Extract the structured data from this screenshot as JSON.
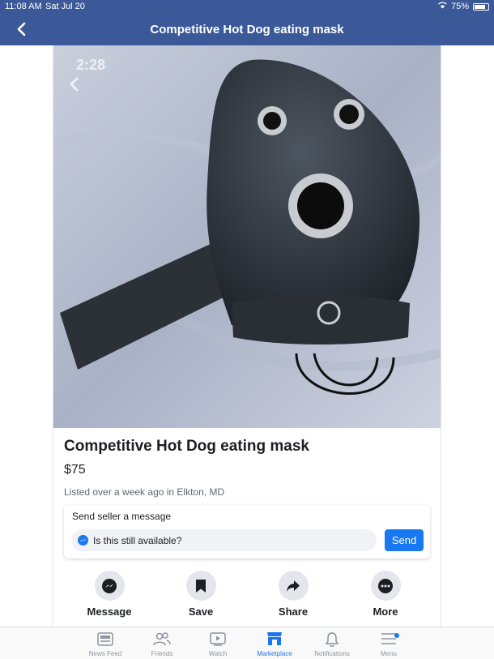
{
  "status_bar": {
    "time": "11:08 AM",
    "date": "Sat Jul 20",
    "battery": "75%"
  },
  "navbar": {
    "title": "Competitive Hot Dog eating mask"
  },
  "photo": {
    "embedded_time": "2:28"
  },
  "listing": {
    "title": "Competitive Hot Dog eating mask",
    "price": "$75",
    "meta": "Listed over a week ago in Elkton, MD"
  },
  "message_box": {
    "heading": "Send seller a message",
    "input_value": "Is this still available?",
    "send_label": "Send"
  },
  "actions": [
    {
      "label": "Message",
      "icon": "messenger-icon"
    },
    {
      "label": "Save",
      "icon": "bookmark-icon"
    },
    {
      "label": "Share",
      "icon": "share-icon"
    },
    {
      "label": "More",
      "icon": "more-icon"
    }
  ],
  "tabs": [
    {
      "label": "News Feed",
      "icon": "news-feed-icon"
    },
    {
      "label": "Friends",
      "icon": "friends-icon"
    },
    {
      "label": "Watch",
      "icon": "watch-icon"
    },
    {
      "label": "Marketplace",
      "icon": "marketplace-icon",
      "active": true
    },
    {
      "label": "Notifications",
      "icon": "bell-icon"
    },
    {
      "label": "Menu",
      "icon": "menu-icon"
    }
  ],
  "colors": {
    "brand": "#3b5998",
    "accent": "#1877f2"
  }
}
